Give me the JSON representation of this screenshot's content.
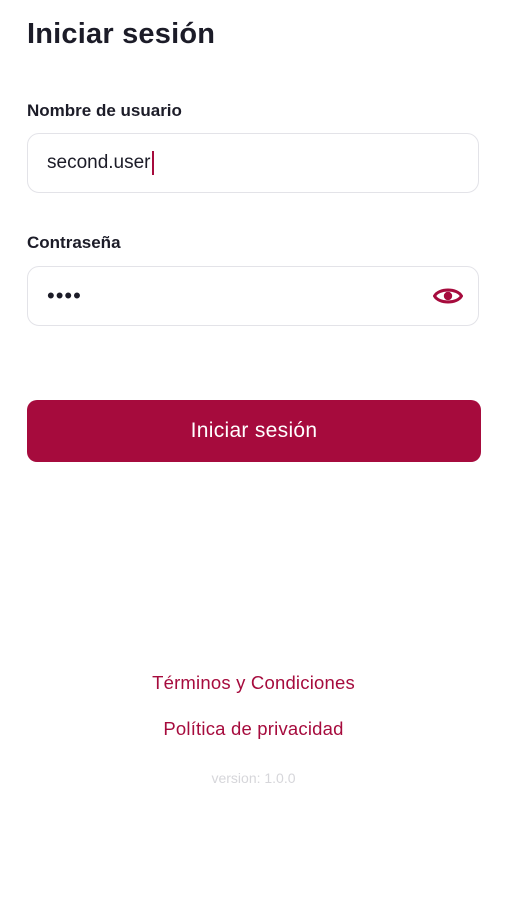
{
  "page": {
    "title": "Iniciar sesión"
  },
  "form": {
    "username": {
      "label": "Nombre de usuario",
      "value": "second.user"
    },
    "password": {
      "label": "Contraseña",
      "masked_value": "••••",
      "toggle_icon": "eye-icon"
    },
    "submit_label": "Iniciar sesión"
  },
  "footer": {
    "terms_label": "Términos y Condiciones",
    "privacy_label": "Política de privacidad",
    "version": "version: 1.0.0"
  },
  "colors": {
    "accent": "#a60b3d",
    "text": "#1c1c28",
    "border": "#e3e3e8",
    "muted": "#d6d6da"
  }
}
